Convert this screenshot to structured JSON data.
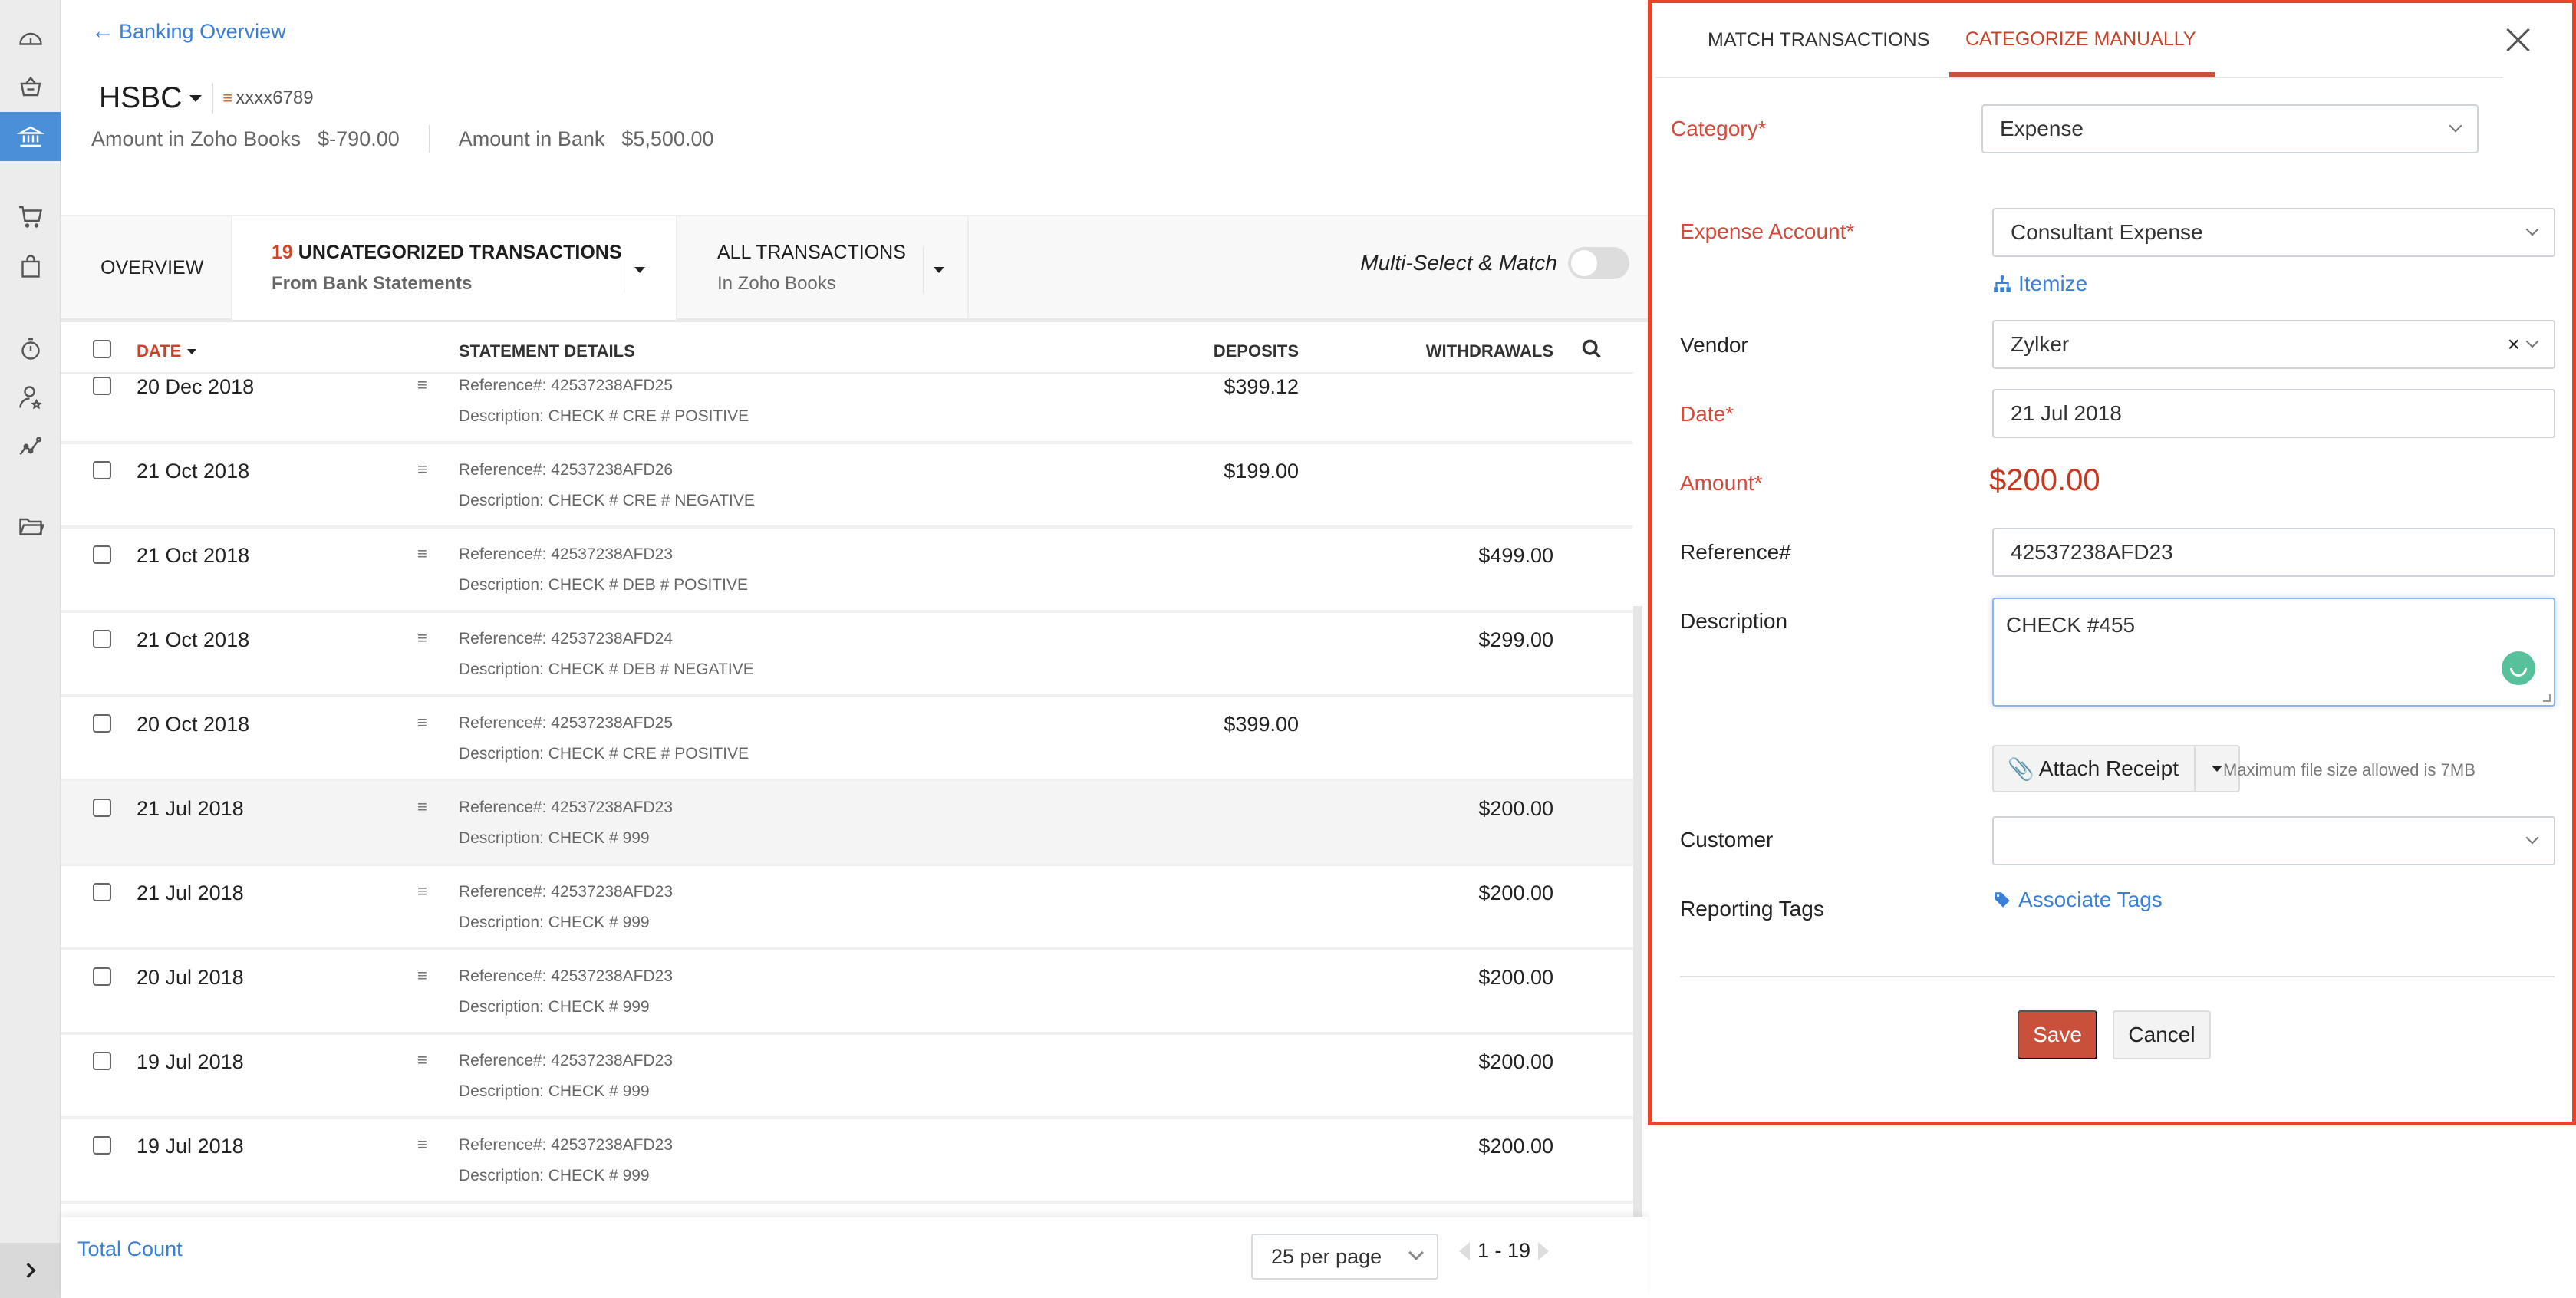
{
  "sidebar": {
    "items": [
      {
        "name": "dashboard",
        "icon": "dashboard-gauge-icon"
      },
      {
        "name": "items",
        "icon": "basket-icon"
      },
      {
        "name": "banking",
        "icon": "bank-icon",
        "active": true
      },
      {
        "name": "sales",
        "icon": "cart-icon"
      },
      {
        "name": "purchases",
        "icon": "shopping-bag-icon"
      },
      {
        "name": "time-tracking",
        "icon": "stopwatch-icon"
      },
      {
        "name": "accountant",
        "icon": "user-star-icon"
      },
      {
        "name": "reports",
        "icon": "chart-line-icon"
      },
      {
        "name": "documents",
        "icon": "folder-icon"
      }
    ],
    "expand_icon": "chevron-right-icon"
  },
  "header": {
    "back_link": "Banking Overview",
    "bank_name": "HSBC",
    "account_number": "xxxx6789",
    "amount_books_label": "Amount in Zoho Books",
    "amount_books_value": "$-790.00",
    "amount_bank_label": "Amount in Bank",
    "amount_bank_value": "$5,500.00"
  },
  "tabs": {
    "overview": "OVERVIEW",
    "uncategorized_count": "19",
    "uncategorized_title": "UNCATEGORIZED TRANSACTIONS",
    "uncategorized_sub": "From Bank Statements",
    "all_title": "ALL TRANSACTIONS",
    "all_sub": "In Zoho Books",
    "multi_select_label": "Multi-Select & Match",
    "multi_select_on": false
  },
  "table": {
    "columns": {
      "date": "DATE",
      "details": "STATEMENT DETAILS",
      "deposits": "DEPOSITS",
      "withdrawals": "WITHDRAWALS"
    },
    "rows": [
      {
        "date": "20 Dec 2018",
        "reference": "Reference#: 42537238AFD25",
        "description": "Description: CHECK # CRE # POSITIVE",
        "deposit": "$399.12",
        "withdrawal": ""
      },
      {
        "date": "21 Oct 2018",
        "reference": "Reference#: 42537238AFD26",
        "description": "Description: CHECK # CRE # NEGATIVE",
        "deposit": "$199.00",
        "withdrawal": ""
      },
      {
        "date": "21 Oct 2018",
        "reference": "Reference#: 42537238AFD23",
        "description": "Description: CHECK # DEB # POSITIVE",
        "deposit": "",
        "withdrawal": "$499.00"
      },
      {
        "date": "21 Oct 2018",
        "reference": "Reference#: 42537238AFD24",
        "description": "Description: CHECK # DEB # NEGATIVE",
        "deposit": "",
        "withdrawal": "$299.00"
      },
      {
        "date": "20 Oct 2018",
        "reference": "Reference#: 42537238AFD25",
        "description": "Description: CHECK # CRE # POSITIVE",
        "deposit": "$399.00",
        "withdrawal": ""
      },
      {
        "date": "21 Jul 2018",
        "reference": "Reference#: 42537238AFD23",
        "description": "Description: CHECK # 999",
        "deposit": "",
        "withdrawal": "$200.00",
        "selected": true
      },
      {
        "date": "21 Jul 2018",
        "reference": "Reference#: 42537238AFD23",
        "description": "Description: CHECK # 999",
        "deposit": "",
        "withdrawal": "$200.00"
      },
      {
        "date": "20 Jul 2018",
        "reference": "Reference#: 42537238AFD23",
        "description": "Description: CHECK # 999",
        "deposit": "",
        "withdrawal": "$200.00"
      },
      {
        "date": "19 Jul 2018",
        "reference": "Reference#: 42537238AFD23",
        "description": "Description: CHECK # 999",
        "deposit": "",
        "withdrawal": "$200.00"
      },
      {
        "date": "19 Jul 2018",
        "reference": "Reference#: 42537238AFD23",
        "description": "Description: CHECK # 999",
        "deposit": "",
        "withdrawal": "$200.00"
      }
    ]
  },
  "footer": {
    "total_count": "Total Count",
    "per_page": "25 per page",
    "page_range": "1 - 19"
  },
  "panel": {
    "tab_match": "MATCH TRANSACTIONS",
    "tab_categorize": "CATEGORIZE MANUALLY",
    "category_label": "Category*",
    "category_value": "Expense",
    "expense_account_label": "Expense Account*",
    "expense_account_value": "Consultant Expense",
    "itemize_link": "Itemize",
    "vendor_label": "Vendor",
    "vendor_value": "Zylker",
    "date_label": "Date*",
    "date_value": "21 Jul 2018",
    "amount_label": "Amount*",
    "amount_value": "$200.00",
    "reference_label": "Reference#",
    "reference_value": "42537238AFD23",
    "description_label": "Description",
    "description_value": "CHECK #455",
    "attach_receipt": "Attach Receipt",
    "attach_note": "Maximum file size allowed is 7MB",
    "customer_label": "Customer",
    "customer_value": "",
    "reporting_tags_label": "Reporting Tags",
    "associate_tags_link": "Associate Tags",
    "save_label": "Save",
    "cancel_label": "Cancel"
  },
  "colors": {
    "accent_blue": "#4a90d9",
    "link_blue": "#3a7fd6",
    "brand_red": "#c9503a",
    "panel_border": "#e8442a",
    "required_red": "#d24a3a"
  }
}
